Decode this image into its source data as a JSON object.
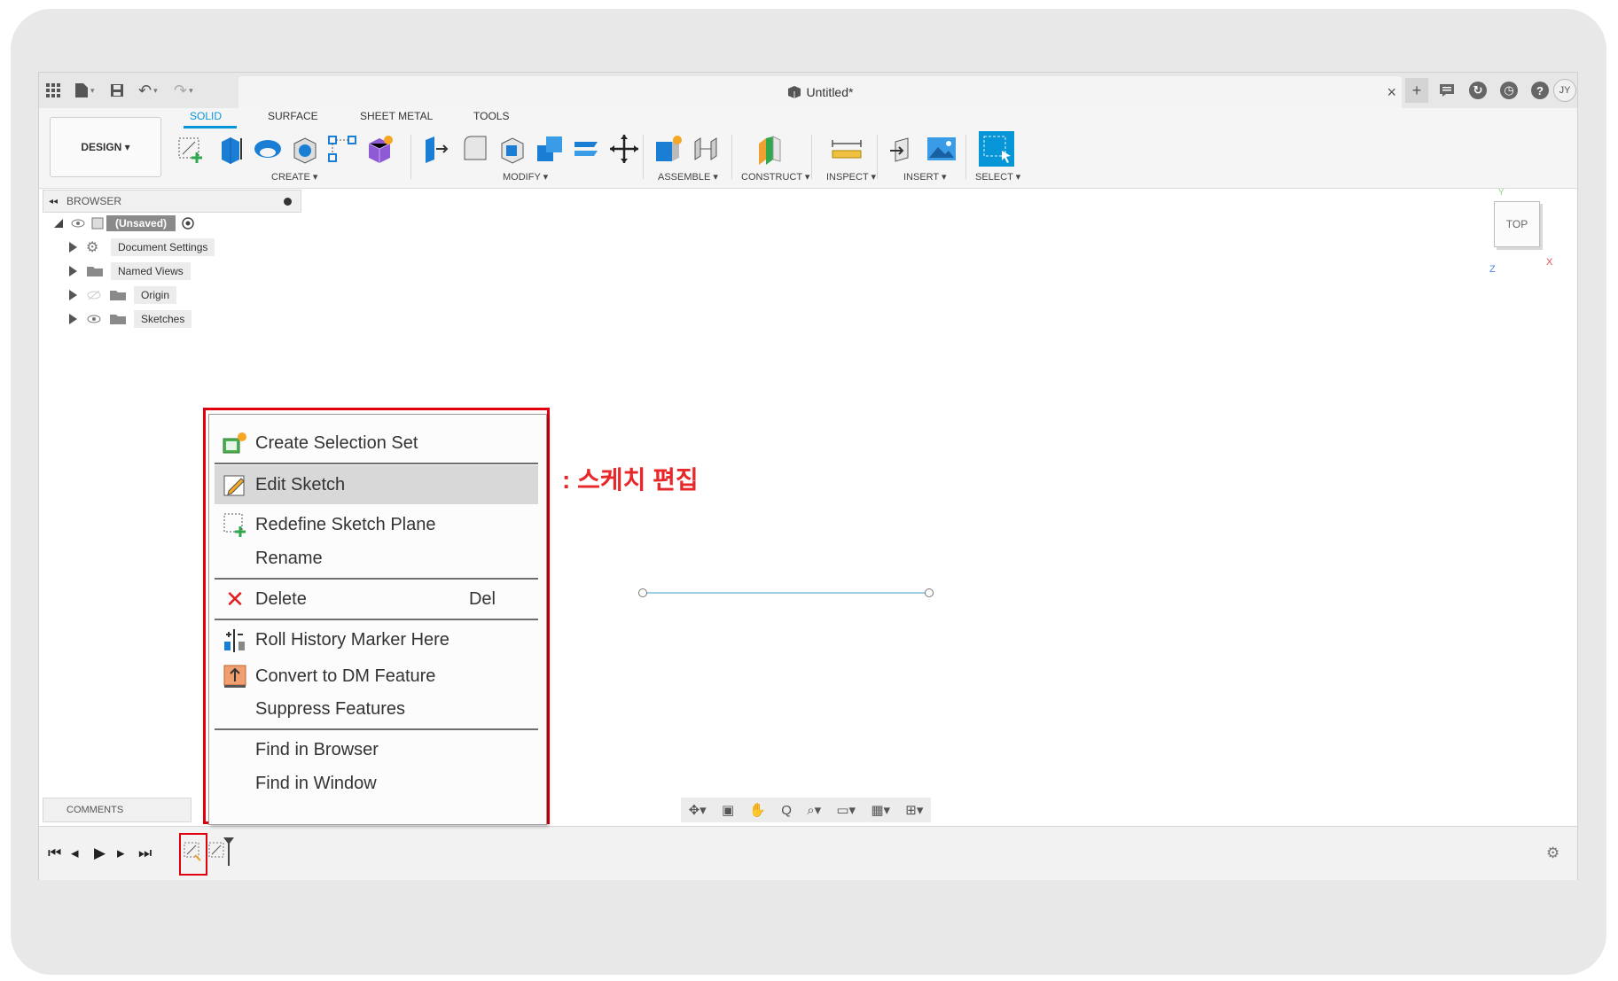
{
  "app": {
    "doc_title": "Untitled*",
    "avatar": "JY"
  },
  "ribbon": {
    "workspace": "DESIGN ▾",
    "tabs": [
      {
        "label": "SOLID",
        "active": true
      },
      {
        "label": "SURFACE",
        "active": false
      },
      {
        "label": "SHEET METAL",
        "active": false
      },
      {
        "label": "TOOLS",
        "active": false
      }
    ],
    "groups": [
      "CREATE ▾",
      "MODIFY ▾",
      "ASSEMBLE ▾",
      "CONSTRUCT ▾",
      "INSPECT ▾",
      "INSERT ▾",
      "SELECT ▾"
    ]
  },
  "browser": {
    "title": "BROWSER",
    "root": "(Unsaved)",
    "items": [
      "Document Settings",
      "Named Views",
      "Origin",
      "Sketches"
    ]
  },
  "viewcube": {
    "face": "TOP",
    "axis_x": "X",
    "axis_y": "Y",
    "axis_z": "Z"
  },
  "comments": {
    "label": "COMMENTS"
  },
  "context_menu": {
    "items": [
      {
        "label": "Create Selection Set",
        "icon": "selection-set-icon"
      },
      {
        "label": "Edit Sketch",
        "icon": "edit-sketch-icon",
        "highlighted": true
      },
      {
        "label": "Redefine Sketch Plane",
        "icon": "redefine-plane-icon"
      },
      {
        "label": "Rename",
        "icon": ""
      },
      {
        "label": "Delete",
        "icon": "delete-icon",
        "shortcut": "Del"
      },
      {
        "label": "Roll History Marker Here",
        "icon": "history-marker-icon"
      },
      {
        "label": "Convert to DM Feature",
        "icon": "convert-dm-icon"
      },
      {
        "label": "Suppress Features",
        "icon": ""
      },
      {
        "label": "Find in Browser",
        "icon": ""
      },
      {
        "label": "Find in Window",
        "icon": ""
      }
    ]
  },
  "annotation": ": 스케치 편집",
  "colors": {
    "accent": "#0696d7",
    "highlight_box": "#e00010",
    "annotation": "#e8272a"
  }
}
